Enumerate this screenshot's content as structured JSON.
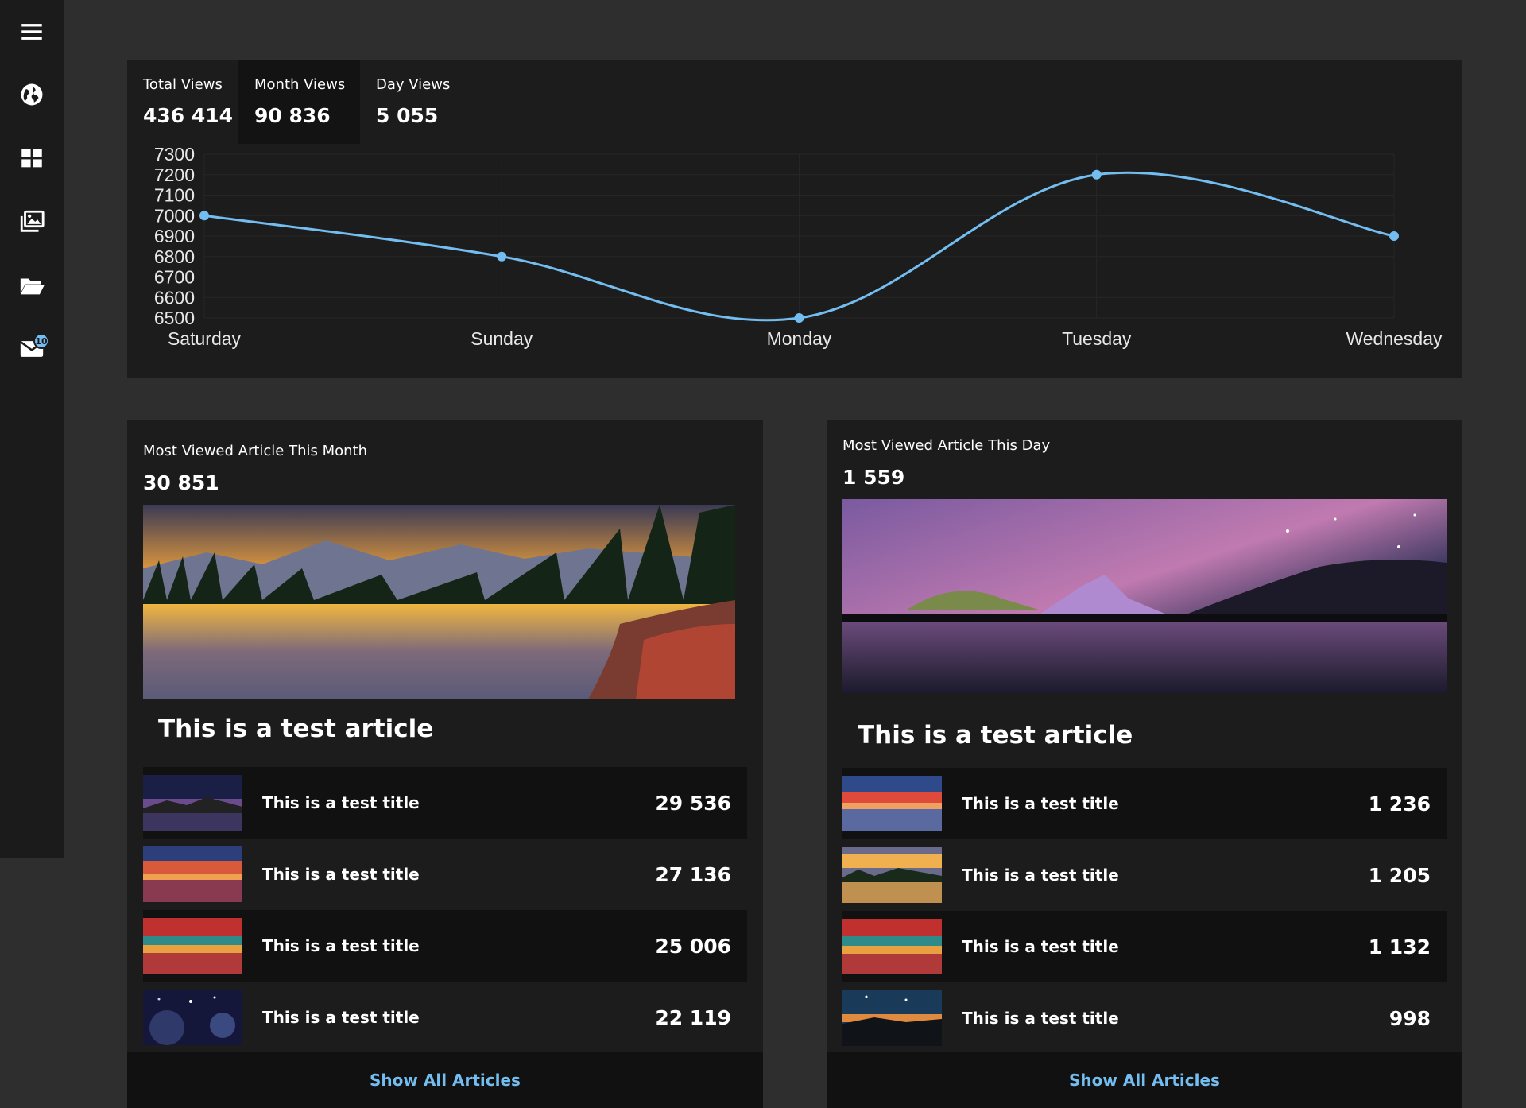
{
  "sidebar": {
    "items": [
      {
        "icon": "menu-icon"
      },
      {
        "icon": "globe-icon"
      },
      {
        "icon": "dashboard-icon"
      },
      {
        "icon": "images-icon"
      },
      {
        "icon": "folder-open-icon"
      },
      {
        "icon": "mail-icon",
        "badge": "10"
      }
    ]
  },
  "stats": {
    "tabs": [
      {
        "label": "Total Views",
        "value": "436 414"
      },
      {
        "label": "Month Views",
        "value": "90 836"
      },
      {
        "label": "Day Views",
        "value": "5 055"
      }
    ]
  },
  "chart_data": {
    "type": "line",
    "categories": [
      "Saturday",
      "Sunday",
      "Monday",
      "Tuesday",
      "Wednesday"
    ],
    "series": [
      {
        "values": [
          7000,
          6800,
          6500,
          7200,
          6900
        ],
        "color": "#74bdf0"
      }
    ],
    "yticks": [
      "7300",
      "7200",
      "7100",
      "7000",
      "6900",
      "6800",
      "6700",
      "6600",
      "6500"
    ],
    "ylim": [
      6500,
      7300
    ],
    "grid": true
  },
  "month_card": {
    "title": "Most Viewed Article This Month",
    "value": "30 851",
    "article_title": "This is a test article",
    "rows": [
      {
        "title": "This is a test title",
        "count": "29 536"
      },
      {
        "title": "This is a test title",
        "count": "27 136"
      },
      {
        "title": "This is a test title",
        "count": "25 006"
      },
      {
        "title": "This is a test title",
        "count": "22 119"
      }
    ],
    "show_all": "Show All Articles"
  },
  "day_card": {
    "title": "Most Viewed Article This Day",
    "value": "1 559",
    "article_title": "This is a test article",
    "rows": [
      {
        "title": "This is a test title",
        "count": "1 236"
      },
      {
        "title": "This is a test title",
        "count": "1 205"
      },
      {
        "title": "This is a test title",
        "count": "1 132"
      },
      {
        "title": "This is a test title",
        "count": "998"
      }
    ],
    "show_all": "Show All Articles"
  },
  "colors": {
    "accent": "#74bdf0",
    "panel": "#1c1c1c",
    "background": "#2e2e2e"
  }
}
